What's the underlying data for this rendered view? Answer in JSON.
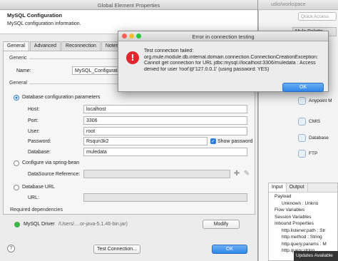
{
  "ide": {
    "title_right": "udio/workspace",
    "quick_access": "Quick Access",
    "palette_tab": "Mule Palette",
    "palette_items": [
      "Anypoint M",
      "CMIS",
      "Database",
      "FTP"
    ],
    "io_tabs": [
      "Input",
      "Output"
    ],
    "io_rows": [
      "Payload",
      "Unknown : Unkno",
      "Flow Variables",
      "Session Variables",
      "Inbound Properties",
      "http.listener.path : Str",
      "http.method : String",
      "http.query.params : M",
      "http.query.string"
    ],
    "status_popup": "Updates Available"
  },
  "dialog": {
    "title": "Global Element Properties",
    "header_title": "MySQL Configuration",
    "header_subtitle": "MySQL configuration information.",
    "tabs": [
      "General",
      "Advanced",
      "Reconnection",
      "Notes"
    ],
    "generic_section": "Generic",
    "name_label": "Name:",
    "name_value": "MySQL_Configuration",
    "general_section": "General",
    "db_params_label": "Database configuration parameters",
    "host_label": "Host:",
    "host_value": "localhost",
    "port_label": "Port:",
    "port_value": "3306",
    "user_label": "User:",
    "user_value": "root",
    "password_label": "Password:",
    "password_value": "Rsqun3k2",
    "show_password_label": "Show password",
    "database_label": "Database:",
    "database_value": "muledata",
    "spring_label": "Configure via spring-bean",
    "datasource_label": "DataSource Reference:",
    "dburl_label": "Database URL",
    "url_label": "URL:",
    "deps_section": "Required dependencies",
    "driver_label": "MySQL Driver",
    "driver_path": "/Users/....or-java-5.1.46-bin.jar)",
    "modify_label": "Modify",
    "help_label": "?",
    "test_label": "Test Connection...",
    "ok_label": "OK"
  },
  "error": {
    "title": "Error in connection testing",
    "icon": "!",
    "lines": [
      "Test connection failed:",
      "org.mule.module.db.internal.domain.connection.ConnectionCreationException:",
      "Cannot get connection for URL jdbc:mysql://localhost:3306/muledata : Access",
      "denied for user 'root'@'127.0.0.1' (using password: YES)"
    ],
    "ok_label": "OK"
  },
  "colors": {
    "error_red": "#e0282e",
    "accent_blue": "#2f86e8"
  }
}
